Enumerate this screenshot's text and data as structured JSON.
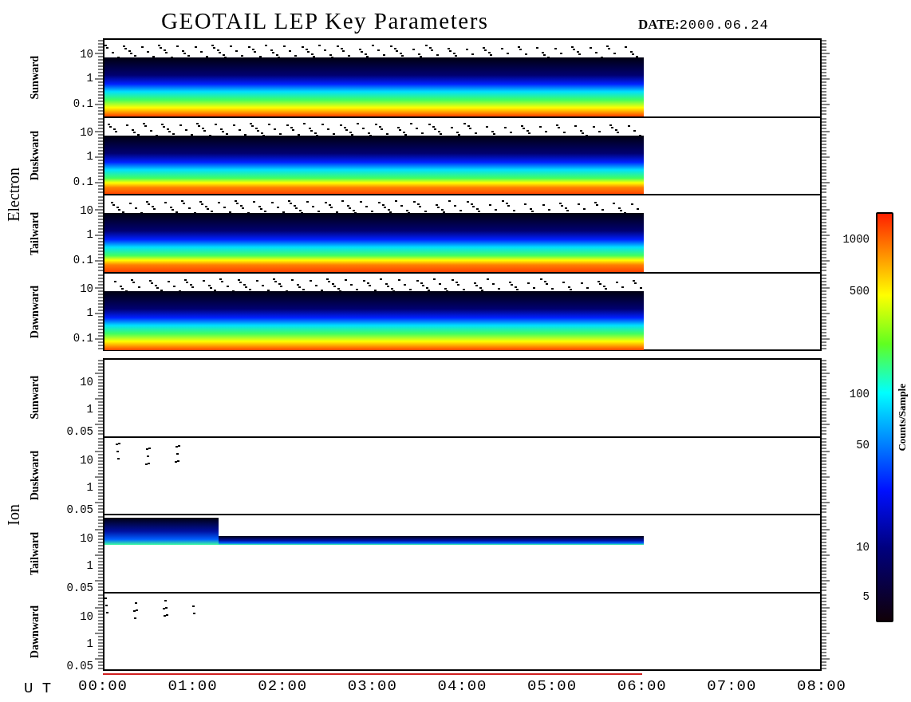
{
  "title": "GEOTAIL LEP Key Parameters",
  "date": {
    "label": "DATE:",
    "value": "2000.06.24"
  },
  "groups": [
    {
      "name": "Electron",
      "kind": "electron",
      "panels": [
        {
          "label": "Sunward",
          "kind": "dense",
          "yticks": [
            "10",
            "1",
            "0.1"
          ]
        },
        {
          "label": "Duskward",
          "kind": "dense_hot",
          "yticks": [
            "10",
            "1",
            "0.1"
          ]
        },
        {
          "label": "Tailward",
          "kind": "dense_hot",
          "yticks": [
            "10",
            "1",
            "0.1"
          ]
        },
        {
          "label": "Dawnward",
          "kind": "dense",
          "yticks": [
            "10",
            "1",
            "0.1"
          ]
        }
      ]
    },
    {
      "name": "Ion",
      "kind": "ion",
      "panels": [
        {
          "label": "Sunward",
          "kind": "empty",
          "yticks": [
            "10",
            "1",
            "0.05"
          ]
        },
        {
          "label": "Duskward",
          "kind": "sparse",
          "yticks": [
            "10",
            "1",
            "0.05"
          ]
        },
        {
          "label": "Tailward",
          "kind": "band",
          "yticks": [
            "10",
            "1",
            "0.05"
          ]
        },
        {
          "label": "Dawnward",
          "kind": "sparse",
          "yticks": [
            "10",
            "1",
            "0.05"
          ]
        }
      ]
    }
  ],
  "x_axis": {
    "label": "U T",
    "ticks": [
      "00:00",
      "01:00",
      "02:00",
      "03:00",
      "04:00",
      "05:00",
      "06:00",
      "07:00",
      "08:00"
    ]
  },
  "colorbar": {
    "label": "Counts/Sample",
    "ticks": [
      "1000",
      "500",
      "100",
      "50",
      "10",
      "5"
    ]
  }
}
